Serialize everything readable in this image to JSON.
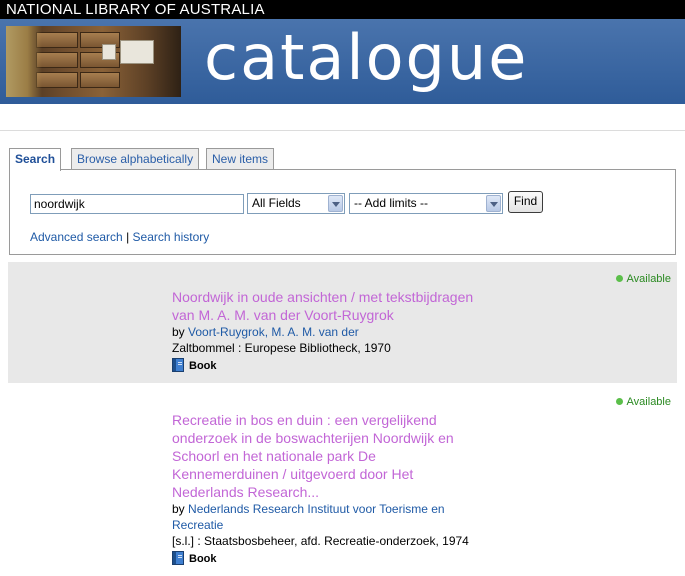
{
  "header": {
    "brand": "NATIONAL LIBRARY OF AUSTRALIA",
    "banner_title": "catalogue"
  },
  "tabs": [
    {
      "label": "Search",
      "active": true
    },
    {
      "label": "Browse alphabetically",
      "active": false
    },
    {
      "label": "New items",
      "active": false
    }
  ],
  "search": {
    "query": "noordwijk",
    "field_select": "All Fields",
    "limits_select": "-- Add limits --",
    "find_label": "Find",
    "advanced_link": "Advanced search",
    "separator": "|",
    "history_link": "Search history"
  },
  "results": [
    {
      "availability": "Available",
      "title_lines": [
        "Noordwijk in oude ansichten / met tekstbijdragen",
        "van M. A. M. van der Voort-Ruygrok"
      ],
      "by_label": "by",
      "author_lines": [
        "Voort-Ruygrok, M. A. M. van der"
      ],
      "publication": "Zaltbommel : Europese Bibliotheck, 1970",
      "format": "Book"
    },
    {
      "availability": "Available",
      "title_lines": [
        "Recreatie in bos en duin : een vergelijkend",
        "onderzoek in de boswachterijen Noordwijk en",
        "Schoorl en het nationale park De",
        "Kennemerduinen / uitgevoerd door Het",
        "Nederlands Research..."
      ],
      "by_label": "by",
      "author_lines": [
        "Nederlands Research Instituut voor Toerisme en",
        "Recreatie"
      ],
      "publication": "[s.l.] : Staatsbosbeheer, afd. Recreatie-onderzoek, 1974",
      "format": "Book"
    }
  ],
  "colors": {
    "title_link": "#c266d6",
    "link": "#1f5aa6",
    "available": "#2b8a22",
    "banner": "#3d679f"
  }
}
